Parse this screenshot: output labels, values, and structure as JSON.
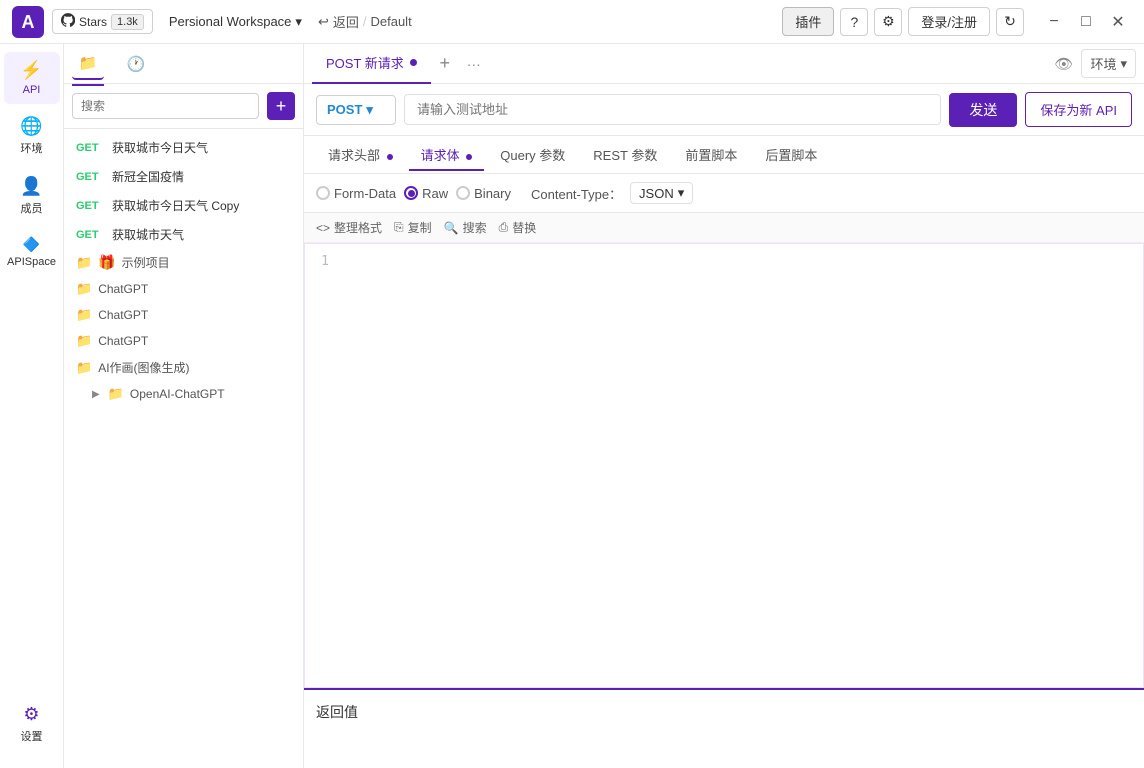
{
  "header": {
    "logo_alt": "APISpace Logo",
    "github_label": "Stars",
    "stars_count": "1.3k",
    "workspace_label": "Persional Workspace",
    "back_label": "返回",
    "breadcrumb_separator": "/",
    "breadcrumb_current": "Default",
    "plugin_btn": "插件",
    "help_icon": "?",
    "settings_icon": "⚙",
    "login_btn": "登录/注册",
    "refresh_icon": "↻",
    "minimize_icon": "−",
    "maximize_icon": "□",
    "close_icon": "✕"
  },
  "sidebar_icons": {
    "items": [
      {
        "icon": "⚡",
        "label": "API",
        "active": true
      },
      {
        "icon": "🌐",
        "label": "环境"
      },
      {
        "icon": "👤",
        "label": "成员"
      },
      {
        "icon": "🔷",
        "label": "APISpace"
      },
      {
        "icon": "⚙",
        "label": "设置"
      }
    ],
    "bottom_icons": [
      {
        "icon": "📂",
        "label": ""
      },
      {
        "icon": "📋",
        "label": ""
      }
    ]
  },
  "left_panel": {
    "tab_folder_icon": "📁",
    "tab_history_icon": "🕐",
    "search_placeholder": "搜索",
    "add_btn": "+",
    "tree_items": [
      {
        "type": "api",
        "method": "GET",
        "label": "获取城市今日天气"
      },
      {
        "type": "api",
        "method": "GET",
        "label": "新冠全国疫情"
      },
      {
        "type": "api",
        "method": "GET",
        "label": "获取城市今日天气 Copy"
      },
      {
        "type": "api",
        "method": "GET",
        "label": "获取城市天气"
      }
    ],
    "folders": [
      {
        "icon": "📁",
        "emoji": "🎁",
        "label": "示例项目",
        "indent": false,
        "expandable": false
      },
      {
        "icon": "📁",
        "label": "ChatGPT",
        "indent": false
      },
      {
        "icon": "📁",
        "label": "ChatGPT",
        "indent": false
      },
      {
        "icon": "📁",
        "label": "ChatGPT",
        "indent": false
      },
      {
        "icon": "📁",
        "label": "AI作画(图像生成)",
        "indent": false
      },
      {
        "icon": "📁",
        "label": "OpenAI-ChatGPT",
        "indent": true,
        "expandable": true
      }
    ]
  },
  "request_tabs": {
    "active_tab": "POST 新请求",
    "tab_dot_color": "#5b21b6",
    "add_icon": "+",
    "more_icon": "···",
    "view_icon": "👁",
    "env_label": "环境",
    "env_dropdown_icon": "▾"
  },
  "url_bar": {
    "method": "POST",
    "method_dropdown_icon": "▾",
    "url_placeholder": "请输入测试地址",
    "send_btn": "发送",
    "save_btn": "保存为新 API"
  },
  "req_config_tabs": {
    "tabs": [
      {
        "label": "请求头部",
        "active": false,
        "dot": false,
        "dot_color": "#5b21b6"
      },
      {
        "label": "请求体",
        "active": true,
        "dot": true,
        "dot_color": "#5b21b6"
      },
      {
        "label": "Query 参数",
        "active": false,
        "dot": false
      },
      {
        "label": "REST 参数",
        "active": false,
        "dot": false
      },
      {
        "label": "前置脚本",
        "active": false,
        "dot": false
      },
      {
        "label": "后置脚本",
        "active": false,
        "dot": false
      }
    ]
  },
  "body_options": {
    "options": [
      {
        "label": "Form-Data",
        "checked": false
      },
      {
        "label": "Raw",
        "checked": true
      },
      {
        "label": "Binary",
        "checked": false
      }
    ],
    "content_type_label": "Content-Type：",
    "content_type_value": "JSON",
    "content_type_dropdown": "▾"
  },
  "editor_toolbar": {
    "format_btn": "整理格式",
    "copy_btn": "复制",
    "search_btn": "搜索",
    "replace_btn": "替换",
    "code_icon": "<>",
    "copy_icon": "⎘",
    "search_icon": "🔍",
    "replace_icon": "⎙"
  },
  "editor": {
    "line_number": "1",
    "content": ""
  },
  "return_section": {
    "title": "返回值"
  },
  "tooltip": {
    "text": "插件"
  }
}
